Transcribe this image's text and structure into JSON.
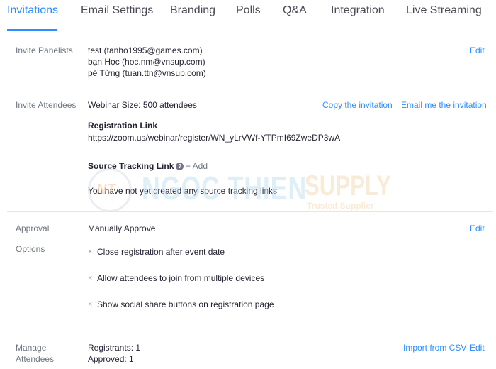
{
  "tabs": [
    {
      "label": "Invitations",
      "active": true
    },
    {
      "label": "Email Settings",
      "active": false
    },
    {
      "label": "Branding",
      "active": false
    },
    {
      "label": "Polls",
      "active": false
    },
    {
      "label": "Q&A",
      "active": false
    },
    {
      "label": "Integration",
      "active": false
    },
    {
      "label": "Live Streaming",
      "active": false
    }
  ],
  "panelists": {
    "label": "Invite Panelists",
    "items": [
      "test (tanho1995@games.com)",
      "bạn Học (hoc.nm@vnsup.com)",
      "pé Tứng (tuan.ttn@vnsup.com)"
    ],
    "edit": "Edit"
  },
  "attendees": {
    "label": "Invite Attendees",
    "webinar_size": "Webinar Size: 500 attendees",
    "copy_invitation": "Copy the invitation",
    "email_invitation": "Email me the invitation",
    "registration_link_title": "Registration Link",
    "registration_link": "https://zoom.us/webinar/register/WN_yLrVWf-YTPmI69ZweDP3wA",
    "source_tracking_title": "Source Tracking Link",
    "help_glyph": "?",
    "add_label": "+ Add",
    "source_tracking_empty": "You have not yet created any source tracking links"
  },
  "approval": {
    "label_line1": "Approval",
    "label_line2": "Options",
    "value": "Manually Approve",
    "edit": "Edit",
    "x_glyph": "×",
    "options": [
      "Close registration after event date",
      "Allow attendees to join from multiple devices",
      "Show social share buttons on registration page"
    ]
  },
  "manage": {
    "label_line1": "Manage",
    "label_line2": "Attendees",
    "registrants": "Registrants: 1",
    "approved": "Approved: 1",
    "import_csv": "Import from CSV",
    "separator": "|",
    "edit": "Edit"
  },
  "watermark": {
    "logo_letters": "NT",
    "brand": "NGOC THIEN",
    "brand2": "SUPPLY",
    "tagline": "Trusted Supplier"
  },
  "colors": {
    "accent": "#2d8cff",
    "text": "#232333",
    "label": "#6e7680",
    "divider": "#e4e4ea"
  }
}
